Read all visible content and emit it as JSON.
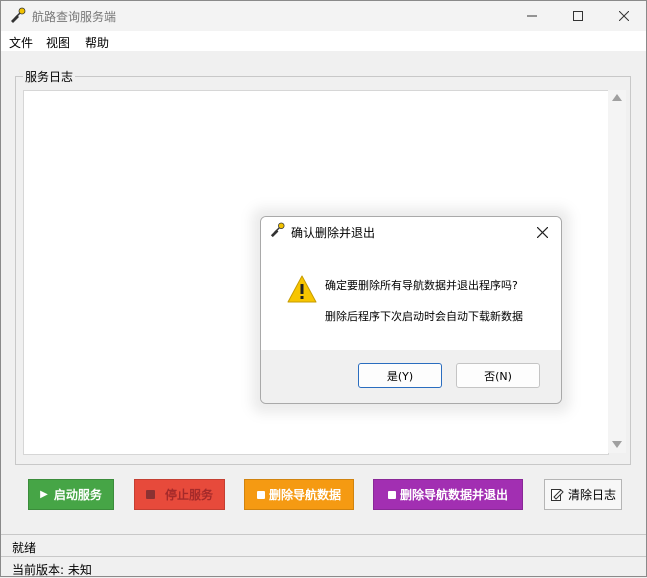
{
  "window": {
    "title": "航路查询服务端"
  },
  "menu": [
    "文件",
    "视图",
    "帮助"
  ],
  "log": {
    "group_label": "服务日志"
  },
  "buttons": {
    "start": "启动服务",
    "stop": "停止服务",
    "delete_nav": "删除导航数据",
    "delete_nav_exit": "删除导航数据并退出",
    "clear_log": "清除日志"
  },
  "status": {
    "state": "就绪",
    "version": "当前版本: 未知"
  },
  "dialog": {
    "title": "确认删除并退出",
    "message_line1": "确定要删除所有导航数据并退出程序吗?",
    "message_line2": "删除后程序下次启动时会自动下载新数据",
    "yes": "是(Y)",
    "no": "否(N)"
  },
  "colors": {
    "start": "#46a546",
    "stop": "#e74a3b",
    "delete_nav": "#f59a12",
    "delete_nav_exit": "#a22fb2",
    "warning": "#f7c500"
  },
  "icons": [
    "app-icon",
    "minimize-icon",
    "maximize-icon",
    "close-icon",
    "play-icon",
    "stop-icon",
    "trash-icon",
    "clear-log-icon",
    "warning-icon"
  ]
}
